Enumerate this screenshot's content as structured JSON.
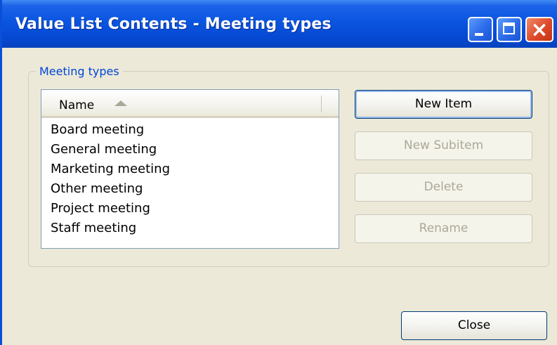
{
  "window": {
    "title": "Value List Contents - Meeting types",
    "controls": {
      "minimize": "minimize-icon",
      "maximize": "maximize-icon",
      "close": "×"
    }
  },
  "group": {
    "label": "Meeting types"
  },
  "list": {
    "column_header": "Name",
    "sort": "ascending",
    "items": [
      "Board meeting",
      "General meeting",
      "Marketing meeting",
      "Other meeting",
      "Project meeting",
      "Staff meeting"
    ]
  },
  "buttons": {
    "new_item": {
      "label": "New Item",
      "enabled": true
    },
    "new_subitem": {
      "label": "New Subitem",
      "enabled": false
    },
    "delete": {
      "label": "Delete",
      "enabled": false
    },
    "rename": {
      "label": "Rename",
      "enabled": false
    },
    "close": {
      "label": "Close",
      "enabled": true
    }
  },
  "colors": {
    "titlebar": "#0548d2",
    "window_bg": "#ece9d8",
    "group_label": "#0046d5"
  }
}
